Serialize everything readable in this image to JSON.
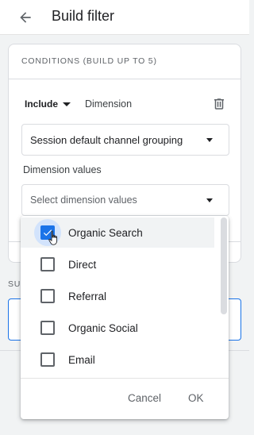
{
  "header": {
    "title": "Build filter",
    "back_icon": "arrow-back-icon"
  },
  "card": {
    "section_title": "CONDITIONS (BUILD UP TO 5)",
    "include_label": "Include",
    "dimension_label": "Dimension",
    "delete_icon": "trash-icon",
    "dimension_select_value": "Session default channel grouping",
    "dimension_values_label": "Dimension values",
    "dimension_values_placeholder": "Select dimension values"
  },
  "below": {
    "section_label_partial": "SU"
  },
  "dropdown": {
    "options": [
      {
        "label": "Organic Search",
        "checked": true
      },
      {
        "label": "Direct",
        "checked": false
      },
      {
        "label": "Referral",
        "checked": false
      },
      {
        "label": "Organic Social",
        "checked": false
      },
      {
        "label": "Email",
        "checked": false
      }
    ],
    "cancel_label": "Cancel",
    "ok_label": "OK"
  },
  "colors": {
    "accent": "#1a73e8",
    "hover_ring": "#d2e3fc"
  }
}
